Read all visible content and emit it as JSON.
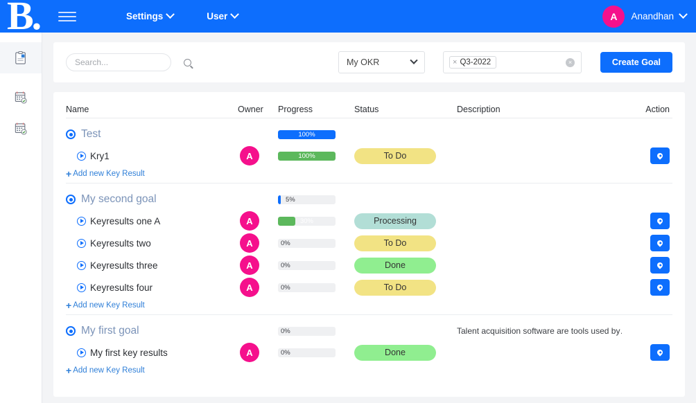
{
  "header": {
    "logo_text": "B.",
    "menu_icon": "hamburger-icon",
    "nav": [
      {
        "label": "Settings"
      },
      {
        "label": "User"
      }
    ],
    "user": {
      "initial": "A",
      "name": "Anandhan"
    },
    "brand_color": "#0d6efd",
    "avatar_color": "#f5108c"
  },
  "sidebar": {
    "items": [
      {
        "icon": "clipboard-icon",
        "active": true
      },
      {
        "icon": "calendar-check-icon",
        "active": false
      },
      {
        "icon": "calendar-check-icon",
        "active": false
      }
    ]
  },
  "filters": {
    "search": {
      "value": "",
      "placeholder": "Search..."
    },
    "okr_select": {
      "value": "My OKR"
    },
    "tags": {
      "chips": [
        "Q3-2022"
      ],
      "clear_label": "×"
    },
    "create_button": "Create Goal"
  },
  "table": {
    "columns": [
      "Name",
      "Owner",
      "Progress",
      "Status",
      "Description",
      "Action"
    ],
    "add_key_result_label": "Add new Key Result",
    "groups": [
      {
        "goal": {
          "name": "Test",
          "progress": 100,
          "progress_label": "100%",
          "description": ""
        },
        "key_results": [
          {
            "name": "Kry1",
            "owner": "A",
            "progress": 100,
            "progress_label": "100%",
            "status": "To Do",
            "status_color": "#f2e384",
            "description": "",
            "action": "pin-icon"
          }
        ]
      },
      {
        "goal": {
          "name": "My second goal",
          "progress": 5,
          "progress_label": "5%",
          "description": ""
        },
        "key_results": [
          {
            "name": "Keyresults one A",
            "owner": "A",
            "progress": 30,
            "progress_label": "30%",
            "status": "Processing",
            "status_color": "#b2ded6",
            "description": "",
            "action": "pin-icon"
          },
          {
            "name": "Keyresults two",
            "owner": "A",
            "progress": 0,
            "progress_label": "0%",
            "status": "To Do",
            "status_color": "#f2e384",
            "description": "",
            "action": "pin-icon"
          },
          {
            "name": "Keyresults three",
            "owner": "A",
            "progress": 0,
            "progress_label": "0%",
            "status": "Done",
            "status_color": "#90ee90",
            "description": "",
            "action": "pin-icon"
          },
          {
            "name": "Keyresults four",
            "owner": "A",
            "progress": 0,
            "progress_label": "0%",
            "status": "To Do",
            "status_color": "#f2e384",
            "description": "",
            "action": "pin-icon"
          }
        ]
      },
      {
        "goal": {
          "name": "My first goal",
          "progress": 0,
          "progress_label": "0%",
          "description": "Talent acquisition software are tools used by…"
        },
        "key_results": [
          {
            "name": "My first key results",
            "owner": "A",
            "progress": 0,
            "progress_label": "0%",
            "status": "Done",
            "status_color": "#90ee90",
            "description": "",
            "action": "pin-icon"
          }
        ]
      }
    ]
  }
}
